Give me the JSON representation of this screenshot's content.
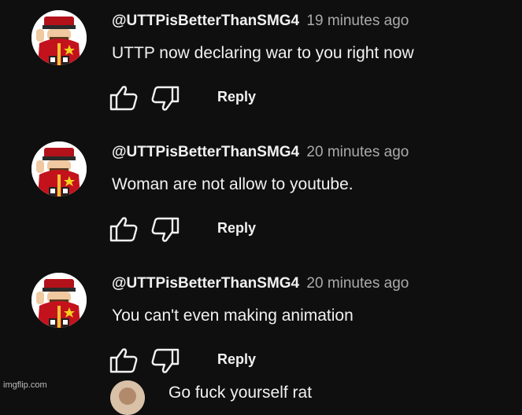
{
  "comments": [
    {
      "author": "@UTTPisBetterThanSMG4",
      "time": "19 minutes ago",
      "text": "UTTP now declaring war to you right now",
      "reply_label": "Reply"
    },
    {
      "author": "@UTTPisBetterThanSMG4",
      "time": "20 minutes ago",
      "text": "Woman are not allow to youtube.",
      "reply_label": "Reply"
    },
    {
      "author": "@UTTPisBetterThanSMG4",
      "time": "20 minutes ago",
      "text": "You can't even making animation",
      "reply_label": "Reply"
    }
  ],
  "partial_comment": {
    "text": "Go fuck yourself rat"
  },
  "icons": {
    "like": "thumbs-up-icon",
    "dislike": "thumbs-down-icon"
  },
  "colors": {
    "background": "#0f0f0f",
    "text": "#f1f1f1",
    "secondary_text": "#aaaaaa"
  },
  "watermark": "imgflip.com"
}
